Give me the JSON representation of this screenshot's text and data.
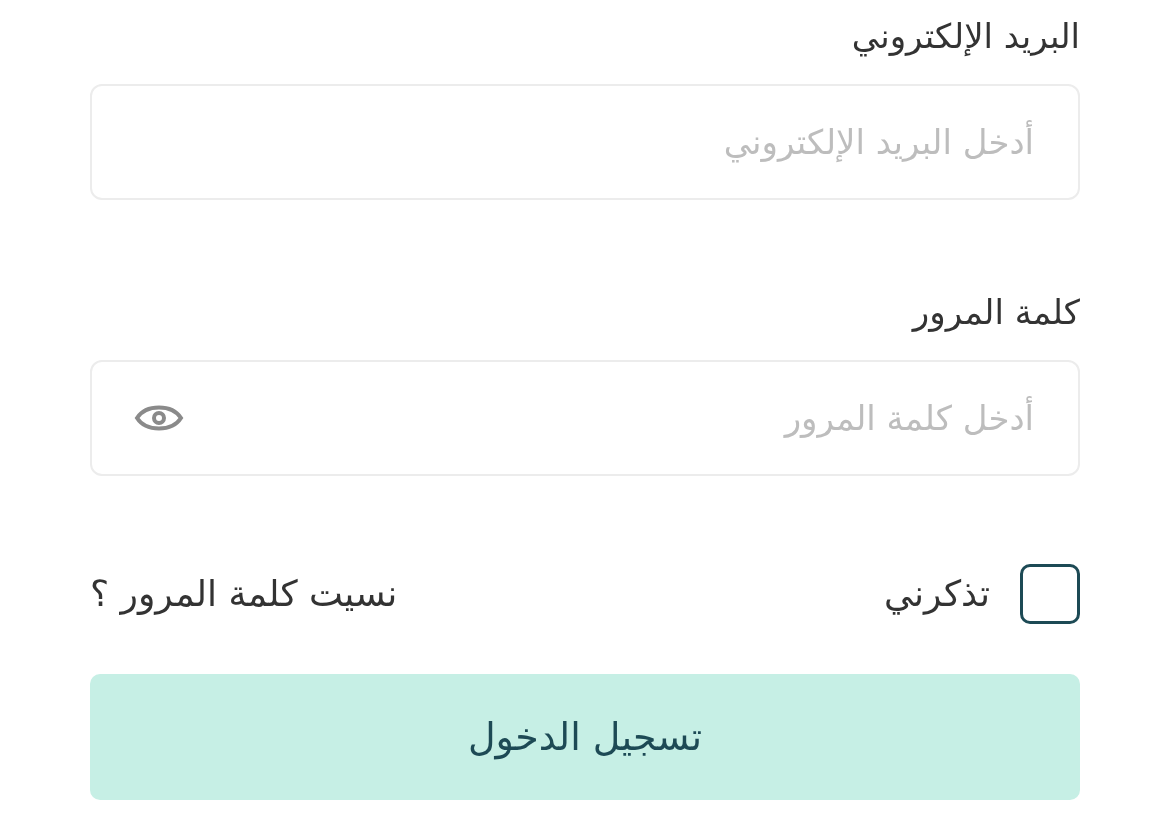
{
  "fields": [
    {
      "kind": "email",
      "label": "البريد الإلكتروني",
      "placeholder": "أدخل البريد الإلكتروني"
    },
    {
      "kind": "password",
      "label": "كلمة المرور",
      "placeholder": "أدخل كلمة المرور"
    }
  ],
  "remember": {
    "label": "تذكرني",
    "checked": false
  },
  "forgot_link": "نسيت كلمة المرور ؟",
  "submit_button": "تسجيل الدخول"
}
